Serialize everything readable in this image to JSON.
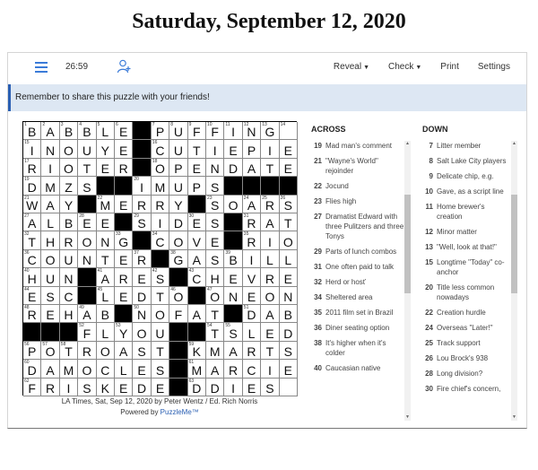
{
  "page_title": "Saturday, September 12, 2020",
  "toolbar": {
    "timer": "26:59",
    "reveal": "Reveal",
    "check": "Check",
    "print": "Print",
    "settings": "Settings"
  },
  "notice": "Remember to share this puzzle with your friends!",
  "grid": {
    "rows": [
      "BABBLE#PUFFING",
      "INOUYE#CUTIEPIE",
      "RIOTER#OPENDATE",
      "DMZS#IMUPSET",
      "WAY#MERRY#SOARS",
      "ALBEE#SIDES#RAT",
      "THRONG#COVE#RIO",
      "COUNTER#GASBILL",
      "HUN#ARES#CHEVRE",
      "ESC#LEDTO#ONEON",
      "REHAB#NOFAT#DAB",
      "#FLYOUTS#LEDA",
      "POTROAST#KMARTS",
      "DAMOCLES#MARCIE",
      "FRISKED#EDDIES"
    ]
  },
  "caption": "LA Times, Sat, Sep 12, 2020 by Peter Wentz / Ed. Rich Norris",
  "powered": {
    "prefix": "Powered by ",
    "link": "PuzzleMe™"
  },
  "across": {
    "heading": "ACROSS",
    "clues": [
      {
        "n": "19",
        "t": "Mad man's comment"
      },
      {
        "n": "21",
        "t": "\"Wayne's World\" rejoinder"
      },
      {
        "n": "22",
        "t": "Jocund"
      },
      {
        "n": "23",
        "t": "Flies high"
      },
      {
        "n": "27",
        "t": "Dramatist Edward with three Pulitzers and three Tonys"
      },
      {
        "n": "29",
        "t": "Parts of lunch combos"
      },
      {
        "n": "31",
        "t": "One often paid to talk"
      },
      {
        "n": "32",
        "t": "Herd or hosť"
      },
      {
        "n": "34",
        "t": "Sheltered area"
      },
      {
        "n": "35",
        "t": "2011 film set in Brazil"
      },
      {
        "n": "36",
        "t": "Diner seating option"
      },
      {
        "n": "38",
        "t": "It's higher when it's colder"
      },
      {
        "n": "40",
        "t": "Caucasian native"
      }
    ]
  },
  "down": {
    "heading": "DOWN",
    "clues": [
      {
        "n": "7",
        "t": "Litter member"
      },
      {
        "n": "8",
        "t": "Salt Lake City players"
      },
      {
        "n": "9",
        "t": "Delicate chip, e.g."
      },
      {
        "n": "10",
        "t": "Gave, as a script line"
      },
      {
        "n": "11",
        "t": "Home brewer's creation"
      },
      {
        "n": "12",
        "t": "Minor matter"
      },
      {
        "n": "13",
        "t": "\"Well, look at that!\""
      },
      {
        "n": "15",
        "t": "Longtime \"Today\" co-anchor"
      },
      {
        "n": "20",
        "t": "Title less common nowadays"
      },
      {
        "n": "22",
        "t": "Creation hurdle"
      },
      {
        "n": "24",
        "t": "Overseas \"Later!\""
      },
      {
        "n": "25",
        "t": "Track support"
      },
      {
        "n": "26",
        "t": "Lou Brock's 938"
      },
      {
        "n": "28",
        "t": "Long division?"
      },
      {
        "n": "30",
        "t": "Fire chief's concern,"
      }
    ]
  }
}
